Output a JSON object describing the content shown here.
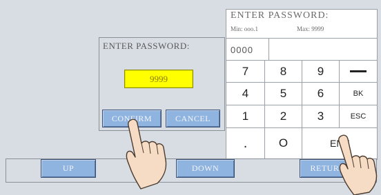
{
  "dialog": {
    "title": "ENTER PASSWORD:",
    "password_value": "9999",
    "confirm_label": "CONFIRM",
    "cancel_label": "CANCEL"
  },
  "keypad": {
    "title": "ENTER PASSWORD:",
    "min_text": "Min: ooo.1",
    "max_text": "Max: 9999",
    "entry_value": "0000",
    "keys": {
      "k7": "7",
      "k8": "8",
      "k9": "9",
      "k4": "4",
      "k5": "5",
      "k6": "6",
      "bk": "BK",
      "k1": "1",
      "k2": "2",
      "k3": "3",
      "esc": "ESC",
      "dot": ".",
      "k0": "O",
      "ent": "ENT"
    },
    "minus_icon": "minus-icon"
  },
  "bottom_bar": {
    "up_label": "UP",
    "down_label": "DOWN",
    "return_label": "RETURN"
  },
  "colors": {
    "background": "#d8dde3",
    "button": "#8fb4e0",
    "password_field": "#ffff00",
    "keypad_bg": "#ffffff"
  },
  "icons": [
    "pointing-hand-icon"
  ]
}
